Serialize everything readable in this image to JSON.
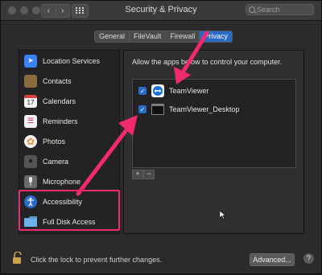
{
  "window": {
    "title": "Security & Privacy",
    "nav_back": "‹",
    "nav_forward": "›"
  },
  "search": {
    "placeholder": "Search"
  },
  "tabs": [
    {
      "label": "General",
      "active": false
    },
    {
      "label": "FileVault",
      "active": false
    },
    {
      "label": "Firewall",
      "active": false
    },
    {
      "label": "Privacy",
      "active": true
    }
  ],
  "sidebar": {
    "items": [
      {
        "label": "Location Services",
        "icon": "location-arrow-icon",
        "color": "#3b82f6",
        "glyph": "➤"
      },
      {
        "label": "Contacts",
        "icon": "contacts-book-icon",
        "color": "#8b6a3c",
        "glyph": "👤"
      },
      {
        "label": "Calendars",
        "icon": "calendar-icon",
        "color": "#f2f2f2",
        "glyph": "17"
      },
      {
        "label": "Reminders",
        "icon": "reminders-list-icon",
        "color": "#f2f2f2",
        "glyph": "☰"
      },
      {
        "label": "Photos",
        "icon": "photos-flower-icon",
        "color": "#f2f2f2",
        "glyph": "✿"
      },
      {
        "label": "Camera",
        "icon": "camera-icon",
        "color": "#6a6a6c",
        "glyph": "●"
      },
      {
        "label": "Microphone",
        "icon": "microphone-icon",
        "color": "#6a6a6c",
        "glyph": "🎤"
      },
      {
        "label": "Accessibility",
        "icon": "accessibility-icon",
        "color": "#2a6ac8",
        "glyph": "♿"
      },
      {
        "label": "Full Disk Access",
        "icon": "folder-icon",
        "color": "#5b9bd5",
        "glyph": ""
      }
    ]
  },
  "panel": {
    "title": "Allow the apps below to control your computer.",
    "apps": [
      {
        "name": "TeamViewer",
        "checked": true,
        "icon": "teamviewer-icon"
      },
      {
        "name": "TeamViewer_Desktop",
        "checked": true,
        "icon": "terminal-app-icon"
      }
    ],
    "add_label": "+",
    "remove_label": "−"
  },
  "footer": {
    "lock_text": "Click the lock to prevent further changes.",
    "advanced_label": "Advanced...",
    "help_label": "?"
  },
  "colors": {
    "accent": "#2a6ac8",
    "annotation": "#f02a6c"
  }
}
